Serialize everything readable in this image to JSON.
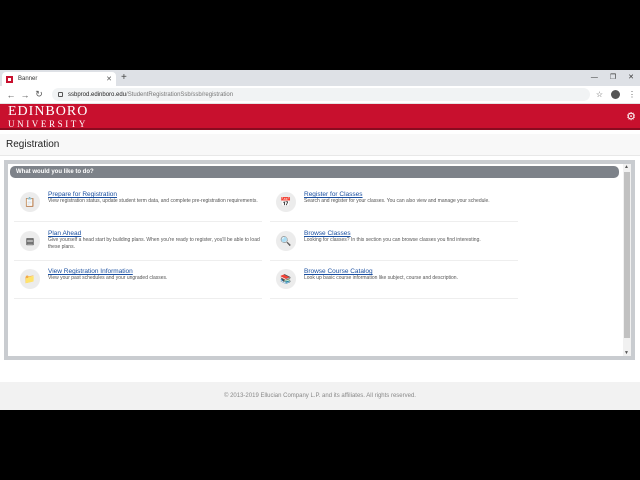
{
  "browser": {
    "tab_title": "Banner",
    "new_tab": "+",
    "url_host": "ssbprod.edinboro.edu",
    "url_path": "/StudentRegistrationSsb/ssb/registration"
  },
  "brand": {
    "line1": "EDINBORO",
    "line2": "UNIVERSITY"
  },
  "page_title": "Registration",
  "panel_title": "What would you like to do?",
  "items": [
    {
      "label": "Prepare for Registration",
      "desc": "View registration status, update student term data, and complete pre-registration requirements.",
      "icon": "clipboard-icon"
    },
    {
      "label": "Register for Classes",
      "desc": "Search and register for your classes. You can also view and manage your schedule.",
      "icon": "calendar-icon"
    },
    {
      "label": "Plan Ahead",
      "desc": "Give yourself a head start by building plans. When you're ready to register, you'll be able to load these plans.",
      "icon": "plan-icon"
    },
    {
      "label": "Browse Classes",
      "desc": "Looking for classes? In this section you can browse classes you find interesting.",
      "icon": "magnifier-icon"
    },
    {
      "label": "View Registration Information",
      "desc": "View your past schedules and your ungraded classes.",
      "icon": "folder-icon"
    },
    {
      "label": "Browse Course Catalog",
      "desc": "Look up basic course information like subject, course and description.",
      "icon": "book-icon"
    }
  ],
  "footer": "© 2013-2019 Ellucian Company L.P. and its affiliates. All rights reserved."
}
